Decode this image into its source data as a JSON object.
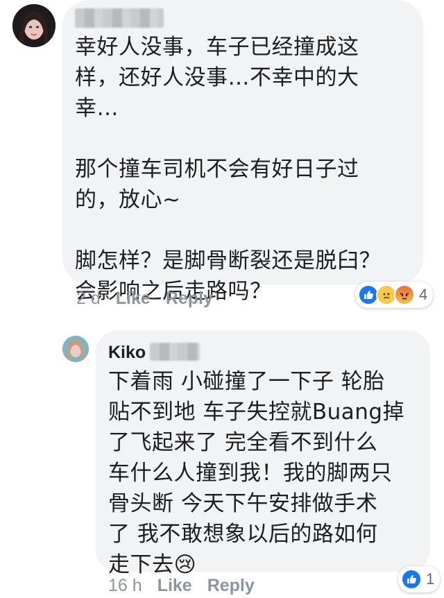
{
  "comment": {
    "text": "幸好人没事，车子已经撞成这\n样，还好人没事…不幸中的大\n幸…\n\n那个撞车司机不会有好日子过\n的，放心~\n\n脚怎样？是脚骨断裂还是脱臼？\n会影响之后走路吗？",
    "time": "2 d",
    "like_label": "Like",
    "reply_label": "Reply",
    "reaction_count": "4",
    "reaction_icons": [
      "like-icon",
      "sad-icon",
      "angry-icon"
    ]
  },
  "reply": {
    "author": "Kiko",
    "text": "下着雨 小碰撞了一下子 轮胎\n贴不到地 车子失控就Buang掉\n了飞起来了 完全看不到什么\n车什么人撞到我！我的脚两只\n骨头断 今天下午安排做手术\n了 我不敢想象以后的路如何\n走下去😢",
    "time": "16 h",
    "like_label": "Like",
    "reply_label": "Reply",
    "reaction_count": "1",
    "reaction_icons": [
      "like-icon"
    ]
  },
  "colors": {
    "bubble": "#f2f3f5",
    "meta_text": "#8d949e",
    "like_blue": "#1877f2"
  }
}
